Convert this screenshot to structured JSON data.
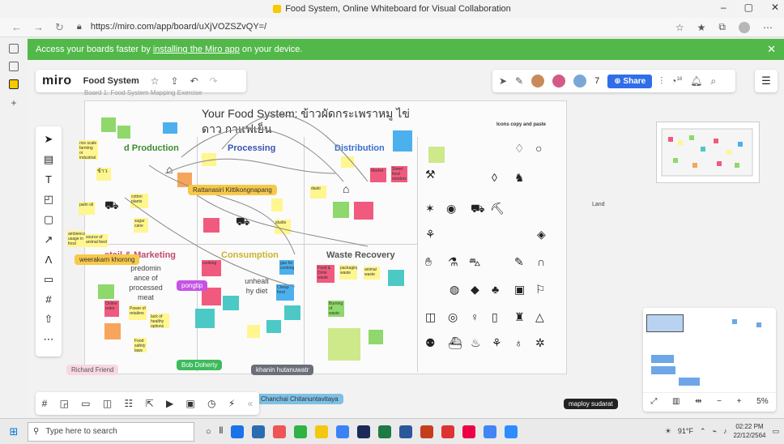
{
  "window": {
    "title": "Food System, Online Whiteboard for Visual Collaboration",
    "controls": [
      "–",
      "▢",
      "✕"
    ]
  },
  "browser": {
    "url": "https://miro.com/app/board/uXjVOZSZvQY=/"
  },
  "banner": {
    "prefix": "Access your boards faster by",
    "link": "installing the Miro app",
    "suffix": "on your device."
  },
  "miro": {
    "logo": "miro",
    "board_name": "Food System",
    "share_label": "Share",
    "collab_count": "7",
    "notif_count": "18"
  },
  "board": {
    "subtitle": "Board 1: Food System Mapping Exercise",
    "title": "Your Food System: ข้าวผัดกระเพราหมู ไข่ดาว กาแฟเย็น",
    "zones": {
      "production": "d Production",
      "processing": "Processing",
      "distribution": "Distribution",
      "retail": "etail & Marketing",
      "consumption": "Consumption",
      "waste": "Waste Recovery"
    },
    "texts": {
      "predominance": "predomin ance of processed meat",
      "unhealthy": "unhealt hy diet"
    },
    "icons_title": "Icons copy and paste",
    "land_label": "Land",
    "stickies": {
      "s1": "rice scale farming or industrial farm",
      "s2": "ข้าว",
      "s3": "cotton plants",
      "s4": "sugar cane",
      "s5": "ambiencx usage in food",
      "s6": "source of animal feed",
      "s7": "daski",
      "s8": "Market",
      "s9": "Street food vendors",
      "s10": "studio",
      "s11": "cooking",
      "s12": "gas for cooking",
      "s13": "Food & Drink waste",
      "s14": "packaging waste",
      "s15": "animal waste",
      "s16": "Cheap food",
      "s17": "Online order",
      "s18": "Power of retailers",
      "s19": "lack of healthy options",
      "s20": "Burning of waste",
      "s21": "palm oil",
      "s22": "Food safety laws"
    }
  },
  "cursors": {
    "rattanasiri": "Rattanasiri Kittikongnapang",
    "weerakarn": "weerakarn khorong",
    "pongtip": "pongtip",
    "richard": "Richard Friend",
    "bob": "Bob Doherty",
    "khanin": "khanin hutanuwatr",
    "chanchai": "Chanchai Chitanuntavitaya",
    "maploy": "maploy sudarat"
  },
  "zoom": "5%",
  "taskbar": {
    "search_placeholder": "Type here to search",
    "weather": "91°F",
    "time": "02:22 PM",
    "date": "22/12/2564"
  }
}
